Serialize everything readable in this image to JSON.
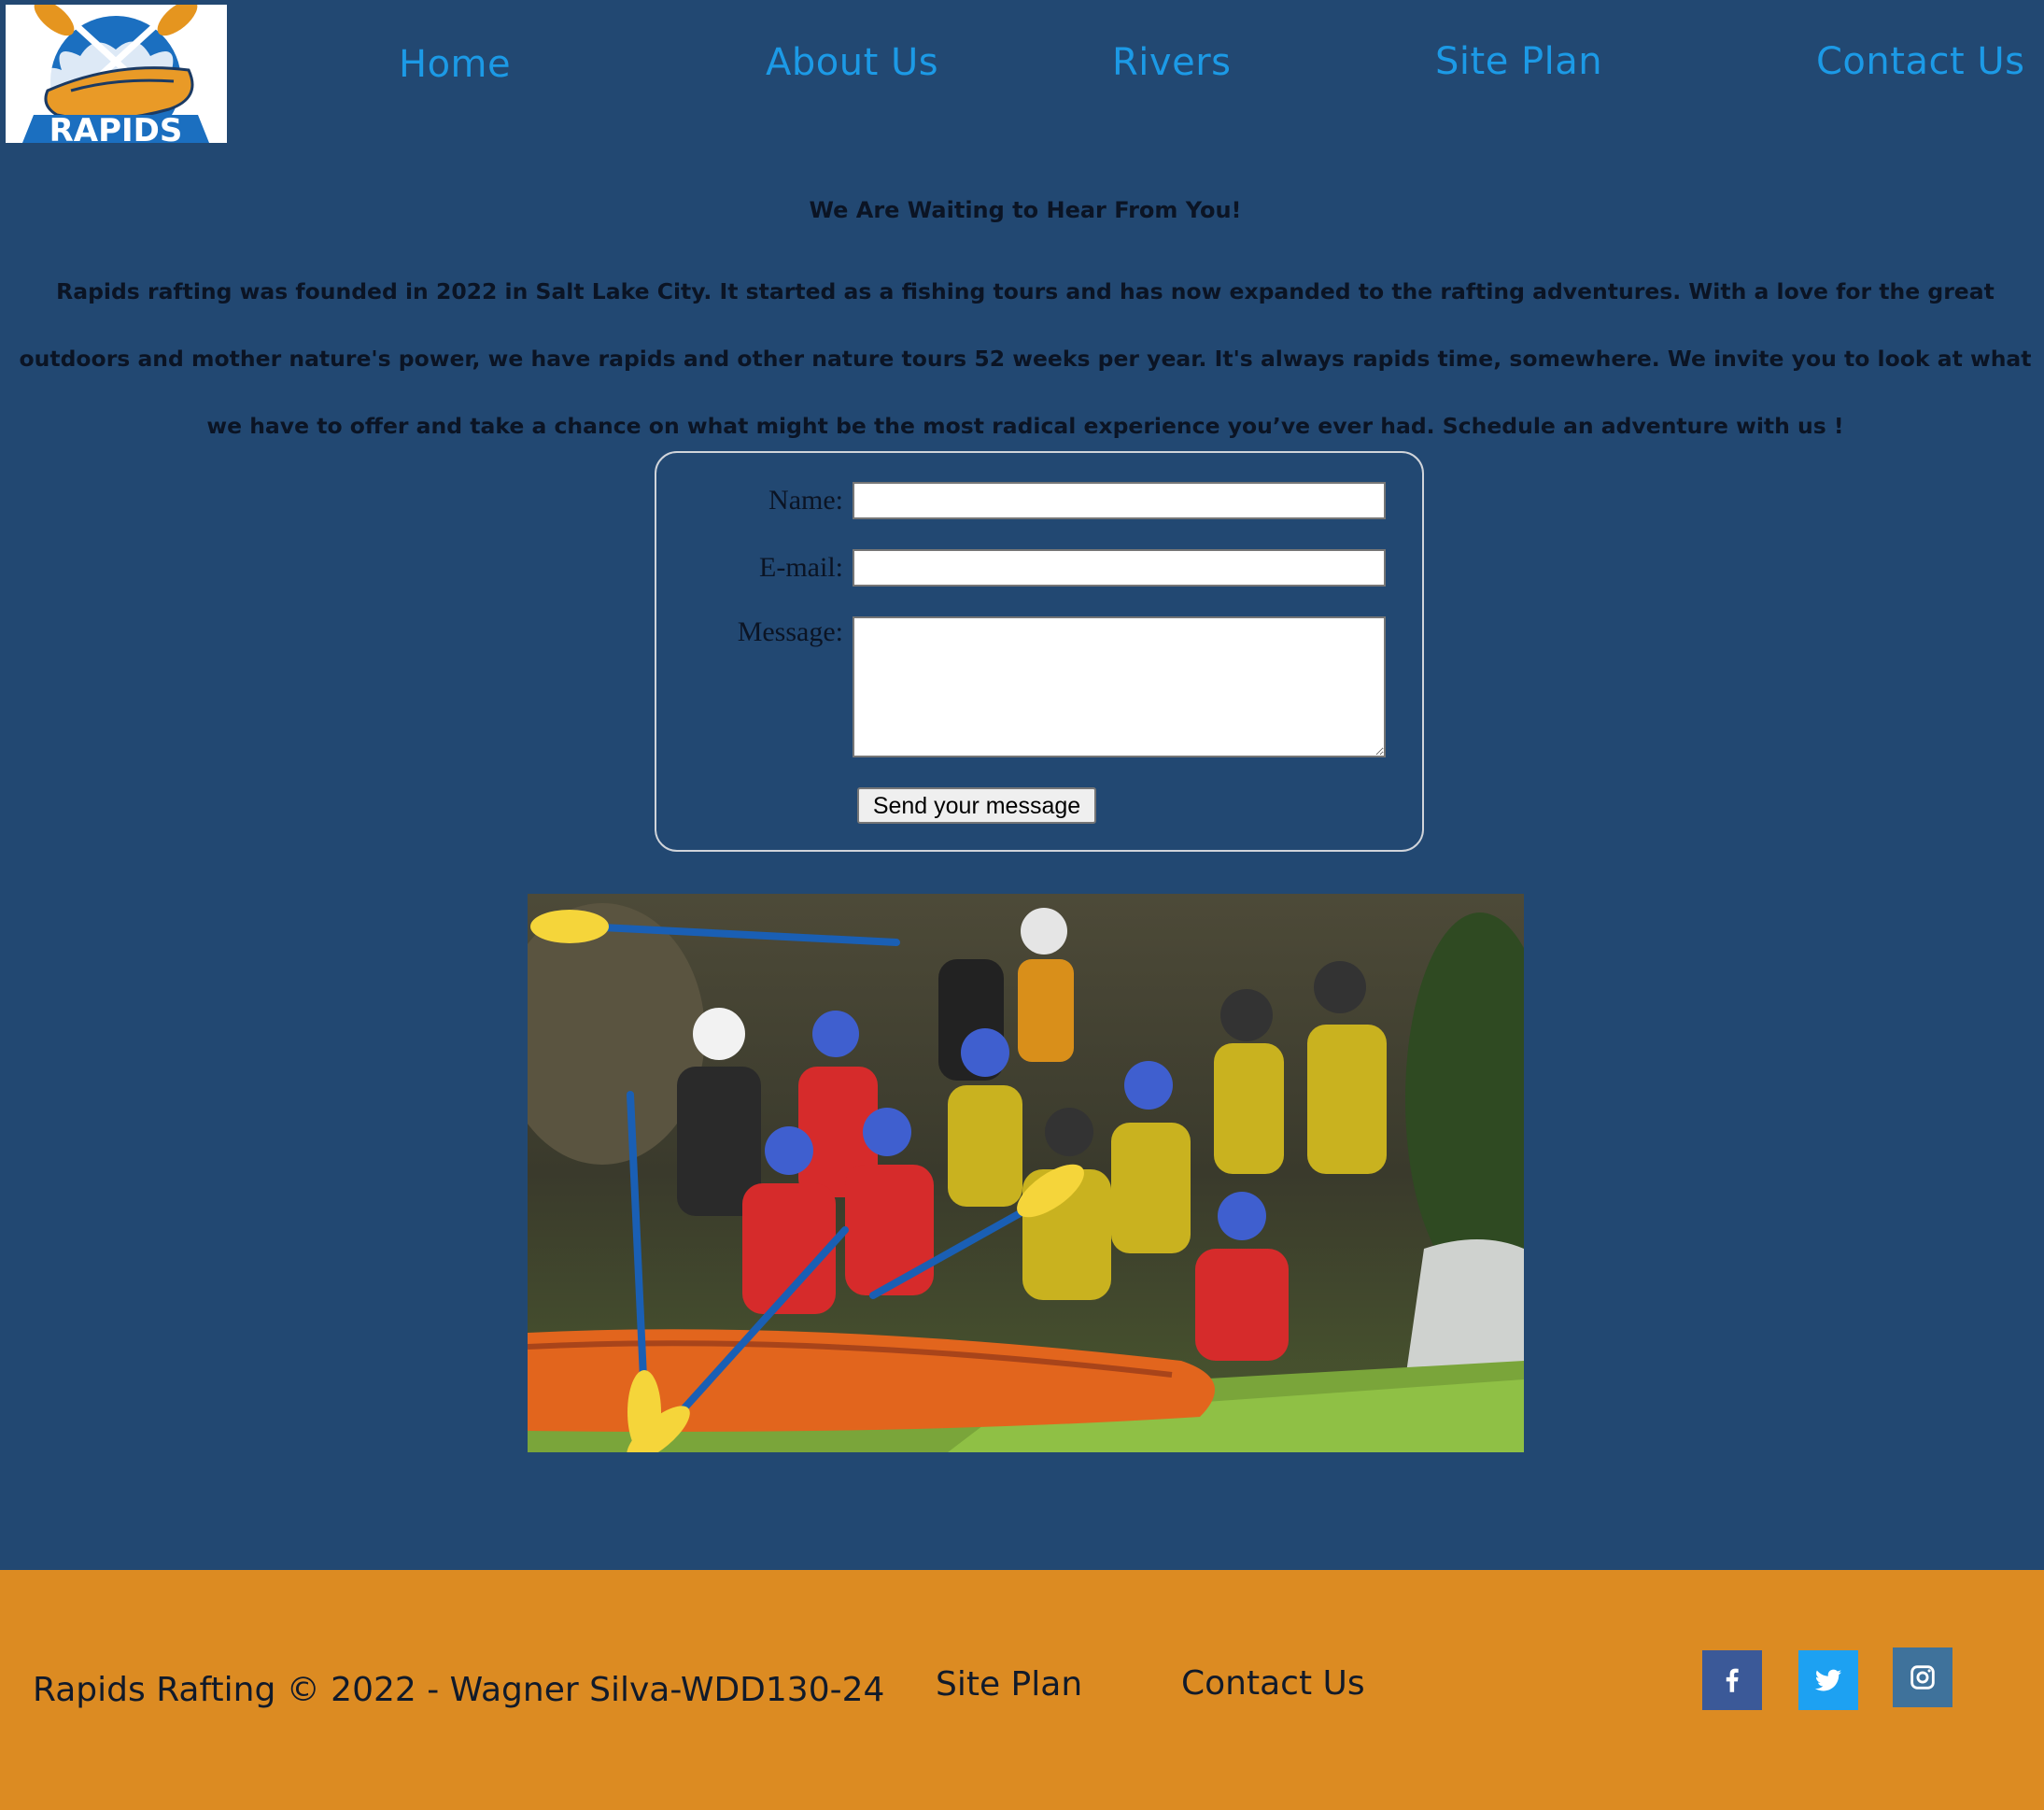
{
  "logo": {
    "text": "RAPIDS"
  },
  "nav": {
    "items": [
      {
        "label": "Home"
      },
      {
        "label": "About Us"
      },
      {
        "label": "Rivers"
      },
      {
        "label": "Site Plan"
      },
      {
        "label": "Contact Us"
      }
    ]
  },
  "intro": {
    "title": "We Are Waiting to Hear From You!",
    "text": "Rapids rafting was founded in 2022 in Salt Lake City. It started as a fishing tours and has now expanded to the rafting adventures. With a love for the great outdoors and mother nature's power, we have rapids and other nature tours 52 weeks per year. It's always rapids time, somewhere. We invite you to look at what we have to offer and take a chance on what might be the most radical experience you’ve ever had. Schedule an adventure with us !"
  },
  "form": {
    "name_label": "Name:",
    "name_value": "",
    "email_label": "E-mail:",
    "email_value": "",
    "message_label": "Message:",
    "message_value": "",
    "submit_label": "Send your message"
  },
  "footer": {
    "copyright": "Rapids Rafting © 2022 - Wagner Silva-WDD130-24",
    "links": [
      {
        "label": "Site Plan"
      },
      {
        "label": "Contact Us"
      }
    ],
    "social": [
      {
        "icon": "facebook-icon",
        "color": "#3b5998"
      },
      {
        "icon": "twitter-icon",
        "color": "#1da1f2"
      },
      {
        "icon": "instagram-icon",
        "color": "#3f729b"
      }
    ]
  },
  "colors": {
    "page_background": "#224872",
    "nav_link": "#1c9ae6",
    "footer_background": "#dc8b22"
  }
}
